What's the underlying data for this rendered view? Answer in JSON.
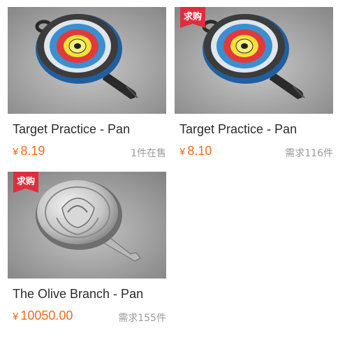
{
  "products": [
    {
      "name": "Target Practice - Pan",
      "currency": "¥",
      "price": "8.19",
      "meta": "1件在售",
      "badge": "",
      "image_icon": "target-pan-icon"
    },
    {
      "name": "Target Practice - Pan",
      "currency": "¥",
      "price": "8.10",
      "meta": "需求116件",
      "badge": "求购",
      "image_icon": "target-pan-icon"
    },
    {
      "name": "The Olive Branch - Pan",
      "currency": "¥",
      "price": "10050.00",
      "meta": "需求155件",
      "badge": "求购",
      "image_icon": "olive-branch-pan-icon"
    }
  ],
  "colors": {
    "price": "#f26b1d",
    "badge": "#e02c3c",
    "meta": "#9a9a9a",
    "name": "#2b2b2b"
  }
}
